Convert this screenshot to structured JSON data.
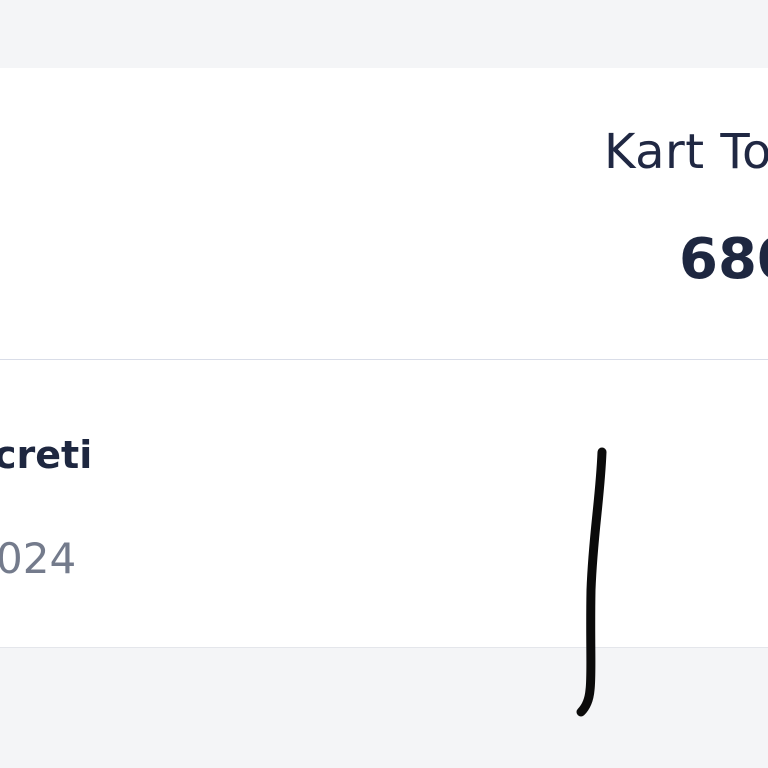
{
  "summary": {
    "label": "Kart To",
    "value": "680"
  },
  "list": {
    "items": [
      {
        "title": "creti",
        "subtitle": "024"
      }
    ]
  },
  "colors": {
    "page_background": "#f4f5f7",
    "card_background": "#ffffff",
    "primary_text": "#1e2740",
    "secondary_text": "#747b8c",
    "divider": "#d9dde8",
    "handwriting": "#0b0b0b"
  }
}
